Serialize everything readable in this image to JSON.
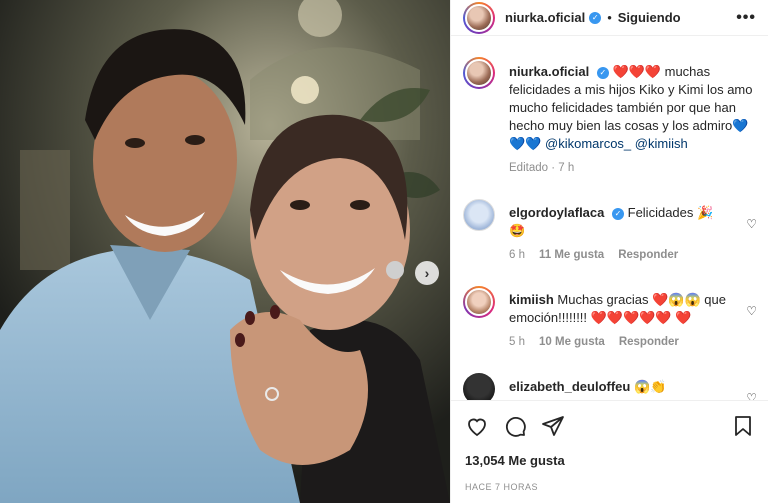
{
  "post": {
    "author": "niurka.oficial",
    "follow_state": "Siguiendo",
    "separator": "•",
    "more": "•••",
    "caption": {
      "user": "niurka.oficial",
      "hearts_start": "❤️❤️❤️",
      "text": " muchas felicidades a mis hijos Kiko y Kimi los amo mucho felicidades también por que han hecho muy bien las cosas y los admiro",
      "hearts_end": "💙💙💙",
      "mention1": "@kikomarcos_",
      "mention2": "@kimiish",
      "edited": "Editado",
      "time": "7 h"
    },
    "comments": [
      {
        "user": "elgordoylaflaca",
        "verified": true,
        "text": "Felicidades 🎉\n🤩",
        "time": "6 h",
        "likes": "11 Me gusta",
        "reply": "Responder"
      },
      {
        "user": "kimiish",
        "verified": false,
        "text": "Muchas gracias ❤️😱😱 que emoción!!!!!!!! ❤️❤️❤️❤️❤️ ❤️",
        "time": "5 h",
        "likes": "10 Me gusta",
        "reply": "Responder"
      },
      {
        "user": "elizabeth_deuloffeu",
        "verified": false,
        "text": "😱👏",
        "time": "",
        "likes": "",
        "reply": ""
      }
    ],
    "likes_count": "13,054 Me gusta",
    "timestamp": "Hace 7 horas",
    "carousel_next": "›"
  }
}
